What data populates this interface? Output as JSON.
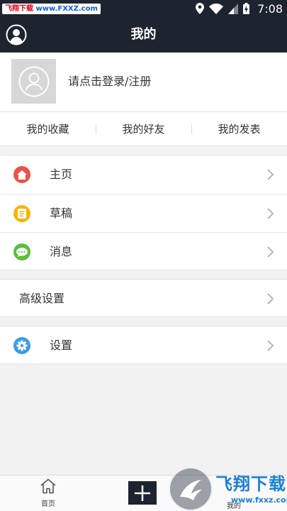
{
  "status_bar": {
    "watermark_cn": "飞翔下载",
    "watermark_url": "www.FXXZ.com",
    "time": "7:08",
    "icons": [
      "location-icon",
      "wifi-icon",
      "signal-icon",
      "battery-charging-icon"
    ]
  },
  "header": {
    "title": "我的",
    "user_icon": "user-circle-icon"
  },
  "profile": {
    "login_text": "请点击登录/注册",
    "avatar_icon": "user-placeholder-icon"
  },
  "shortcuts": [
    {
      "label": "我的收藏"
    },
    {
      "label": "我的好友"
    },
    {
      "label": "我的发表"
    }
  ],
  "menu_group_1": [
    {
      "label": "主页",
      "icon": "home-icon",
      "color": "#e8534a"
    },
    {
      "label": "草稿",
      "icon": "draft-icon",
      "color": "#f6b400"
    },
    {
      "label": "消息",
      "icon": "message-icon",
      "color": "#5cbe3c"
    }
  ],
  "menu_group_2": [
    {
      "label": "高级设置"
    }
  ],
  "menu_group_3": [
    {
      "label": "设置",
      "icon": "settings-gear-icon",
      "color": "#3a9be8"
    }
  ],
  "tab_bar": {
    "home_label": "首页",
    "add_icon": "plus-icon",
    "mine_label": "我的"
  },
  "watermark_bottom": {
    "cn": "飞翔下载",
    "url": "www.fxxz.com"
  },
  "colors": {
    "header_bg": "#1e2330",
    "page_bg": "#f2f2f2",
    "chevron": "#b5b5b5"
  }
}
